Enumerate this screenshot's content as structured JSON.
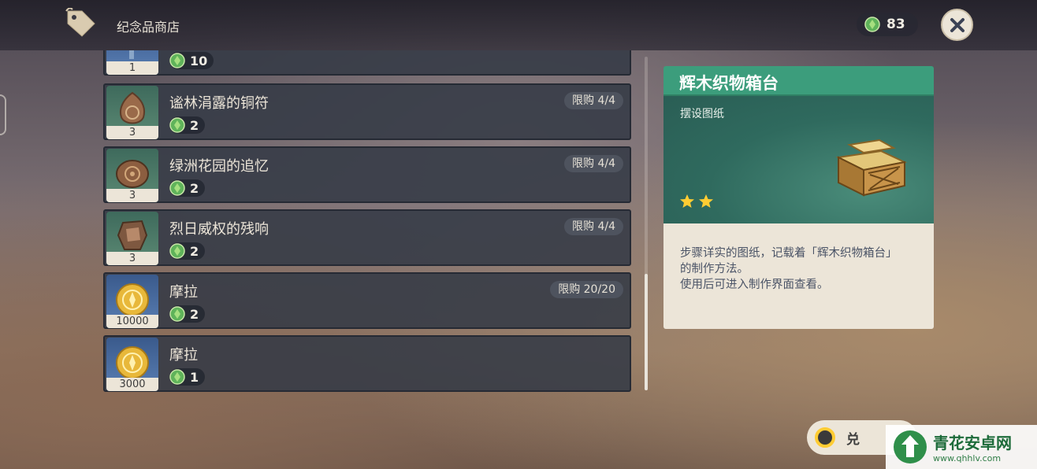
{
  "header": {
    "shop_title": "纪念品商店",
    "currency_value": "83"
  },
  "items": [
    {
      "name": "",
      "qty": "1",
      "price": "10",
      "limit": "",
      "thumb": "blue",
      "icon": "partial-item-icon"
    },
    {
      "name": "谧林涓露的铜符",
      "qty": "3",
      "price": "2",
      "limit": "限购 4/4",
      "thumb": "green",
      "icon": "bronze-charm-icon"
    },
    {
      "name": "绿洲花园的追忆",
      "qty": "3",
      "price": "2",
      "limit": "限购 4/4",
      "thumb": "green",
      "icon": "oasis-memento-icon"
    },
    {
      "name": "烈日威权的残响",
      "qty": "3",
      "price": "2",
      "limit": "限购 4/4",
      "thumb": "green",
      "icon": "sunscorch-relic-icon"
    },
    {
      "name": "摩拉",
      "qty": "10000",
      "price": "2",
      "limit": "限购 20/20",
      "thumb": "blue",
      "icon": "mora-coin-icon"
    },
    {
      "name": "摩拉",
      "qty": "3000",
      "price": "1",
      "limit": "",
      "thumb": "blue",
      "icon": "mora-coin-icon"
    }
  ],
  "detail": {
    "title": "辉木织物箱台",
    "type": "摆设图纸",
    "stars": 2,
    "description_lines": [
      "步骤详实的图纸，记载着「辉木织物箱台」",
      "的制作方法。",
      "使用后可进入制作界面查看。"
    ]
  },
  "redeem_button": {
    "label": "兑"
  },
  "watermark": {
    "name": "青花安卓网",
    "url": "www.qhhlv.com"
  },
  "colors": {
    "detail_header": "#3c9d7c",
    "panel_bg": "#ece5d8",
    "star": "#ffcc33",
    "currency_green": "#5fb35a"
  }
}
